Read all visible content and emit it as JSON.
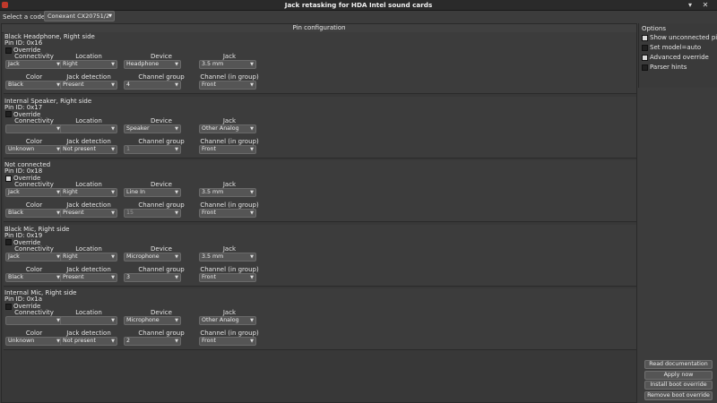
{
  "window": {
    "title": "Jack retasking for HDA Intel sound cards"
  },
  "codec": {
    "label": "Select a codec:",
    "value": "Conexant CX20751/2"
  },
  "pin_config": {
    "title": "Pin configuration",
    "override_label": "Override",
    "column_labels": [
      "Connectivity",
      "Location",
      "Device",
      "Jack",
      "Color",
      "Jack detection",
      "Channel group",
      "Channel (in group)"
    ],
    "sections": [
      {
        "title": "Black Headphone, Right side",
        "pin_id": "Pin ID: 0x16",
        "override": false,
        "values": [
          "Jack",
          "Right",
          "Headphone",
          "3.5 mm",
          "Black",
          "Present",
          "4",
          "Front"
        ]
      },
      {
        "title": "Internal Speaker, Right side",
        "pin_id": "Pin ID: 0x17",
        "override": false,
        "values": [
          "",
          "",
          "Speaker",
          "Other Analog",
          "Unknown",
          "Not present",
          "1",
          "Front"
        ]
      },
      {
        "title": "Not connected",
        "pin_id": "Pin ID: 0x18",
        "override": true,
        "values": [
          "Jack",
          "Right",
          "Line In",
          "3.5 mm",
          "Black",
          "Present",
          "15",
          "Front"
        ]
      },
      {
        "title": "Black Mic, Right side",
        "pin_id": "Pin ID: 0x19",
        "override": false,
        "values": [
          "Jack",
          "Right",
          "Microphone",
          "3.5 mm",
          "Black",
          "Present",
          "3",
          "Front"
        ]
      },
      {
        "title": "Internal Mic, Right side",
        "pin_id": "Pin ID: 0x1a",
        "override": false,
        "values": [
          "",
          "",
          "Microphone",
          "Other Analog",
          "Unknown",
          "Not present",
          "2",
          "Front"
        ]
      }
    ]
  },
  "options": {
    "title": "Options",
    "items": [
      {
        "label": "Show unconnected pins",
        "checked": true
      },
      {
        "label": "Set model=auto",
        "checked": false
      },
      {
        "label": "Advanced override",
        "checked": true
      },
      {
        "label": "Parser hints",
        "checked": false
      }
    ]
  },
  "buttons": {
    "read_docs": "Read documentation",
    "apply_now": "Apply now",
    "install_boot": "Install boot override",
    "remove_boot": "Remove boot override"
  },
  "colors": {
    "background": "#3c3c3c",
    "titlebar": "#2a2a2a",
    "combo": "#555555",
    "text": "#e6e6e6"
  },
  "icons": {
    "app": "sound-card-icon",
    "minimize": "chevron-down-icon",
    "close": "close-icon",
    "dropdown": "dropdown-arrow-icon"
  }
}
